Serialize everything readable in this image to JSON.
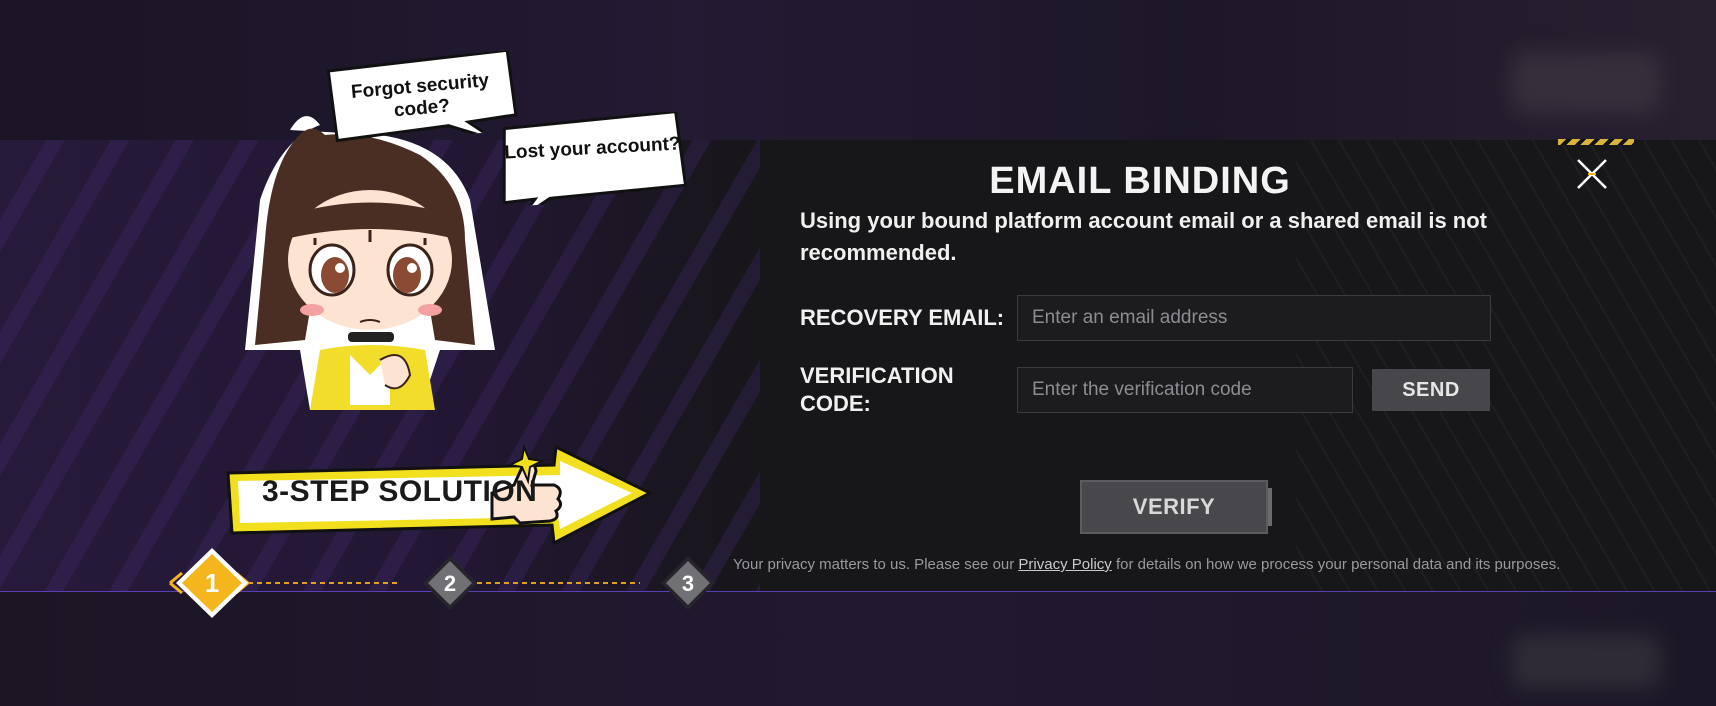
{
  "dialog": {
    "title": "EMAIL BINDING",
    "notice": "Using your bound platform account email or a shared email is not recommended.",
    "close_icon": "close-icon",
    "recovery_email": {
      "label": "RECOVERY EMAIL:",
      "placeholder": "Enter an email address",
      "value": ""
    },
    "verification_code": {
      "label": "VERIFICATION CODE:",
      "placeholder": "Enter the verification code",
      "value": ""
    },
    "send_label": "SEND",
    "verify_label": "VERIFY",
    "privacy": {
      "prefix": "Your privacy matters to us. Please see our ",
      "link": "Privacy Policy",
      "suffix": " for details on how we process your personal data and its purposes."
    }
  },
  "illustration": {
    "bubble1": "Forgot security code?",
    "bubble2": "Lost your account?",
    "banner": "3-STEP SOLUTION"
  },
  "steps": {
    "current": 1,
    "items": [
      "1",
      "2",
      "3"
    ]
  },
  "colors": {
    "accent": "#f5b51d",
    "band": "#171619",
    "purple_line": "#5a3fb3",
    "button": "#47464b"
  }
}
